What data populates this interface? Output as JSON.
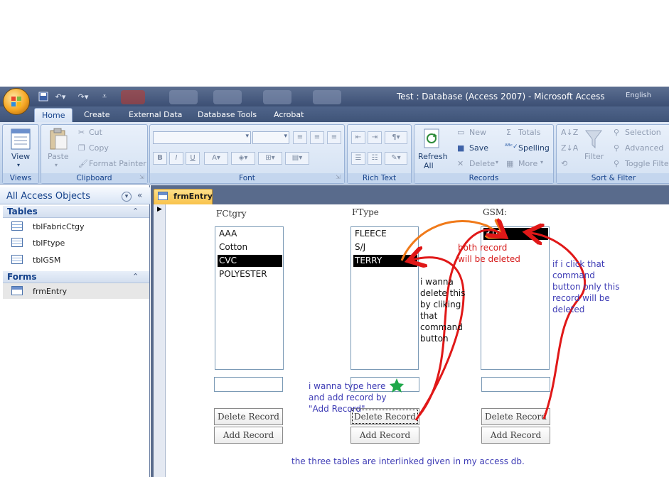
{
  "window": {
    "title": "Test : Database (Access 2007) - Microsoft Access",
    "language": "English"
  },
  "ribbon": {
    "tabs": [
      "Home",
      "Create",
      "External Data",
      "Database Tools",
      "Acrobat"
    ],
    "active_tab": "Home",
    "views": {
      "view_label": "View",
      "group_label": "Views"
    },
    "clipboard": {
      "paste": "Paste",
      "cut": "Cut",
      "copy": "Copy",
      "format_painter": "Format Painter",
      "group_label": "Clipboard"
    },
    "font": {
      "group_label": "Font"
    },
    "rich_text": {
      "group_label": "Rich Text"
    },
    "records": {
      "refresh": "Refresh",
      "refresh_sub": "All",
      "new": "New",
      "save": "Save",
      "delete": "Delete",
      "totals": "Totals",
      "spelling": "Spelling",
      "more": "More",
      "group_label": "Records"
    },
    "sort_filter": {
      "filter": "Filter",
      "selection": "Selection",
      "advanced": "Advanced",
      "toggle_filter": "Toggle Filte",
      "group_label": "Sort & Filter"
    }
  },
  "nav": {
    "title": "All Access Objects",
    "sections": [
      {
        "label": "Tables",
        "items": [
          "tblFabricCtgy",
          "tblFtype",
          "tblGSM"
        ]
      },
      {
        "label": "Forms",
        "items": [
          "frmEntry"
        ]
      }
    ]
  },
  "document": {
    "tab_label": "frmEntry",
    "fields": [
      {
        "label": "FCtgry",
        "items": [
          "AAA",
          "Cotton",
          "CVC",
          "POLYESTER"
        ],
        "selected": "CVC",
        "delete_label": "Delete Record",
        "add_label": "Add Record"
      },
      {
        "label": "FType",
        "items": [
          "FLEECE",
          "S/J",
          "TERRY"
        ],
        "selected": "TERRY",
        "delete_label": "Delete Record",
        "add_label": "Add Record"
      },
      {
        "label": "GSM:",
        "items": [
          "310"
        ],
        "selected": "310",
        "delete_label": "Delete Record",
        "add_label": "Add Record"
      }
    ]
  },
  "annotations": {
    "delete_this": "i wanna\ndelete this\nby cliking\nthat\ncommand\nbutton",
    "both_deleted": "both record\nwill be deleted",
    "only_this": "if i click that\ncommand\nbutton only this\nrecord will be\ndeleted",
    "type_here": "i wanna type here\nand add record by\n\"Add Record\"",
    "footer": "the three tables are interlinked given in my access db.",
    "colors": {
      "blue": "#3d3bb5",
      "red": "#d61c1c",
      "orange": "#f07a1a",
      "green": "#1fa84a"
    }
  }
}
